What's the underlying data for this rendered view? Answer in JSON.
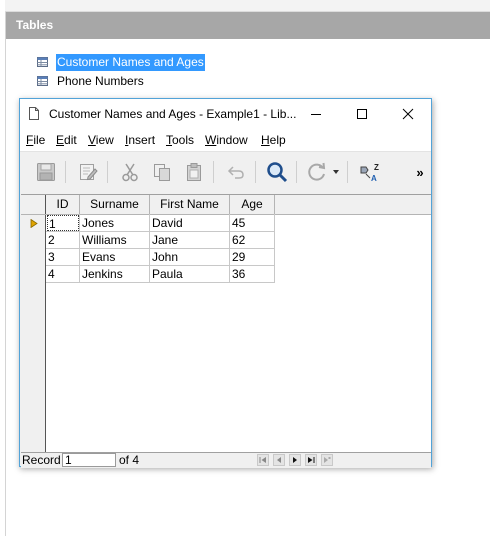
{
  "panel": {
    "header": "Tables",
    "tables": [
      {
        "label": "Customer Names and Ages",
        "selected": true
      },
      {
        "label": "Phone Numbers",
        "selected": false
      }
    ]
  },
  "window": {
    "title": "Customer Names and Ages - Example1 - Lib...",
    "menus": [
      {
        "accel": "F",
        "rest": "ile"
      },
      {
        "accel": "E",
        "rest": "dit"
      },
      {
        "accel": "V",
        "rest": "iew"
      },
      {
        "accel": "I",
        "rest": "nsert"
      },
      {
        "accel": "T",
        "rest": "ools"
      },
      {
        "accel": "W",
        "rest": "indow"
      },
      {
        "accel": "H",
        "rest": "elp"
      }
    ],
    "toolbar": {
      "icons": [
        "save-icon",
        "edit-icon",
        "cut-icon",
        "copy-icon",
        "paste-icon",
        "undo-icon",
        "find-icon",
        "refresh-icon",
        "sort-icon",
        "more-icon"
      ],
      "overflow": "»"
    },
    "grid": {
      "columns": [
        "ID",
        "Surname",
        "First Name",
        "Age"
      ],
      "rows": [
        [
          "1",
          "Jones",
          "David",
          "45"
        ],
        [
          "2",
          "Williams",
          "Jane",
          "62"
        ],
        [
          "3",
          "Evans",
          "John",
          "29"
        ],
        [
          "4",
          "Jenkins",
          "Paula",
          "36"
        ]
      ]
    },
    "status": {
      "record_label": "Record",
      "record_value": "1",
      "of_text": "of 4"
    }
  },
  "colors": {
    "header_bg": "#a7a7a7",
    "selection": "#3399ff",
    "window_border": "#52a3d8",
    "current_row_marker": "#e0a400"
  }
}
